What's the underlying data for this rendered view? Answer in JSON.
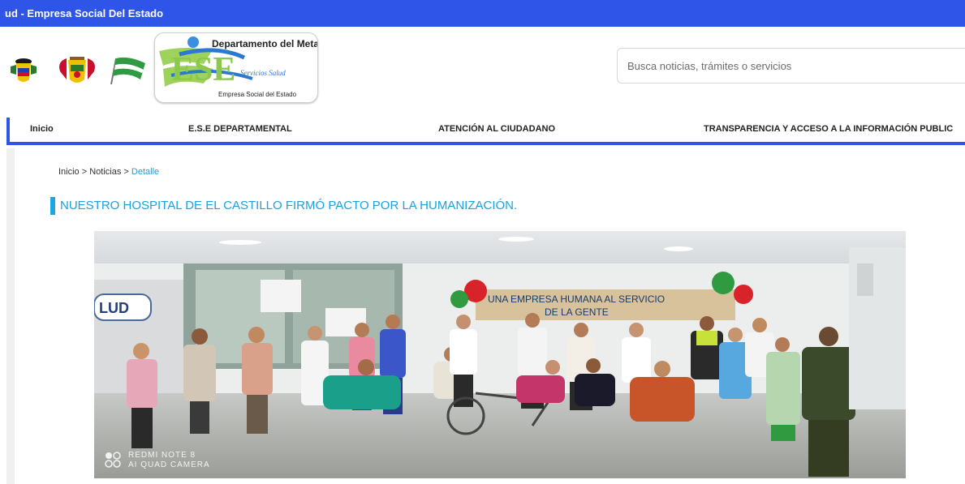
{
  "topbar": {
    "text": "ud - Empresa Social Del Estado"
  },
  "header": {
    "logo": {
      "line1": "Departamento del Meta",
      "script": "Servicios Salud",
      "line3": "Empresa Social del Estado",
      "mark": "ESE"
    },
    "search": {
      "placeholder": "Busca noticias, trámites o servicios",
      "value": ""
    }
  },
  "nav": {
    "items": [
      {
        "label": "Inicio"
      },
      {
        "label": "E.S.E DEPARTAMENTAL"
      },
      {
        "label": "ATENCIÓN AL CIUDADANO"
      },
      {
        "label": "TRANSPARENCIA Y ACCESO A LA INFORMACIÓN PUBLIC"
      }
    ]
  },
  "breadcrumb": {
    "home": "Inicio",
    "sep1": " > ",
    "section": "Noticias",
    "sep2": " > ",
    "current": "Detalle"
  },
  "article": {
    "title": "NUESTRO HOSPITAL DE EL CASTILLO FIRMÓ PACTO POR LA HUMANIZACIÓN.",
    "photo": {
      "banner_line1": "UNA EMPRESA HUMANA AL SERVICIO",
      "banner_line2": "DE LA GENTE",
      "wall_sign": "LUD",
      "watermark_line1": "REDMI NOTE 8",
      "watermark_line2": "AI QUAD CAMERA"
    }
  },
  "colors": {
    "brand_blue": "#2f55e8",
    "title_blue": "#1da0dc",
    "link_blue": "#2a9bd6"
  }
}
